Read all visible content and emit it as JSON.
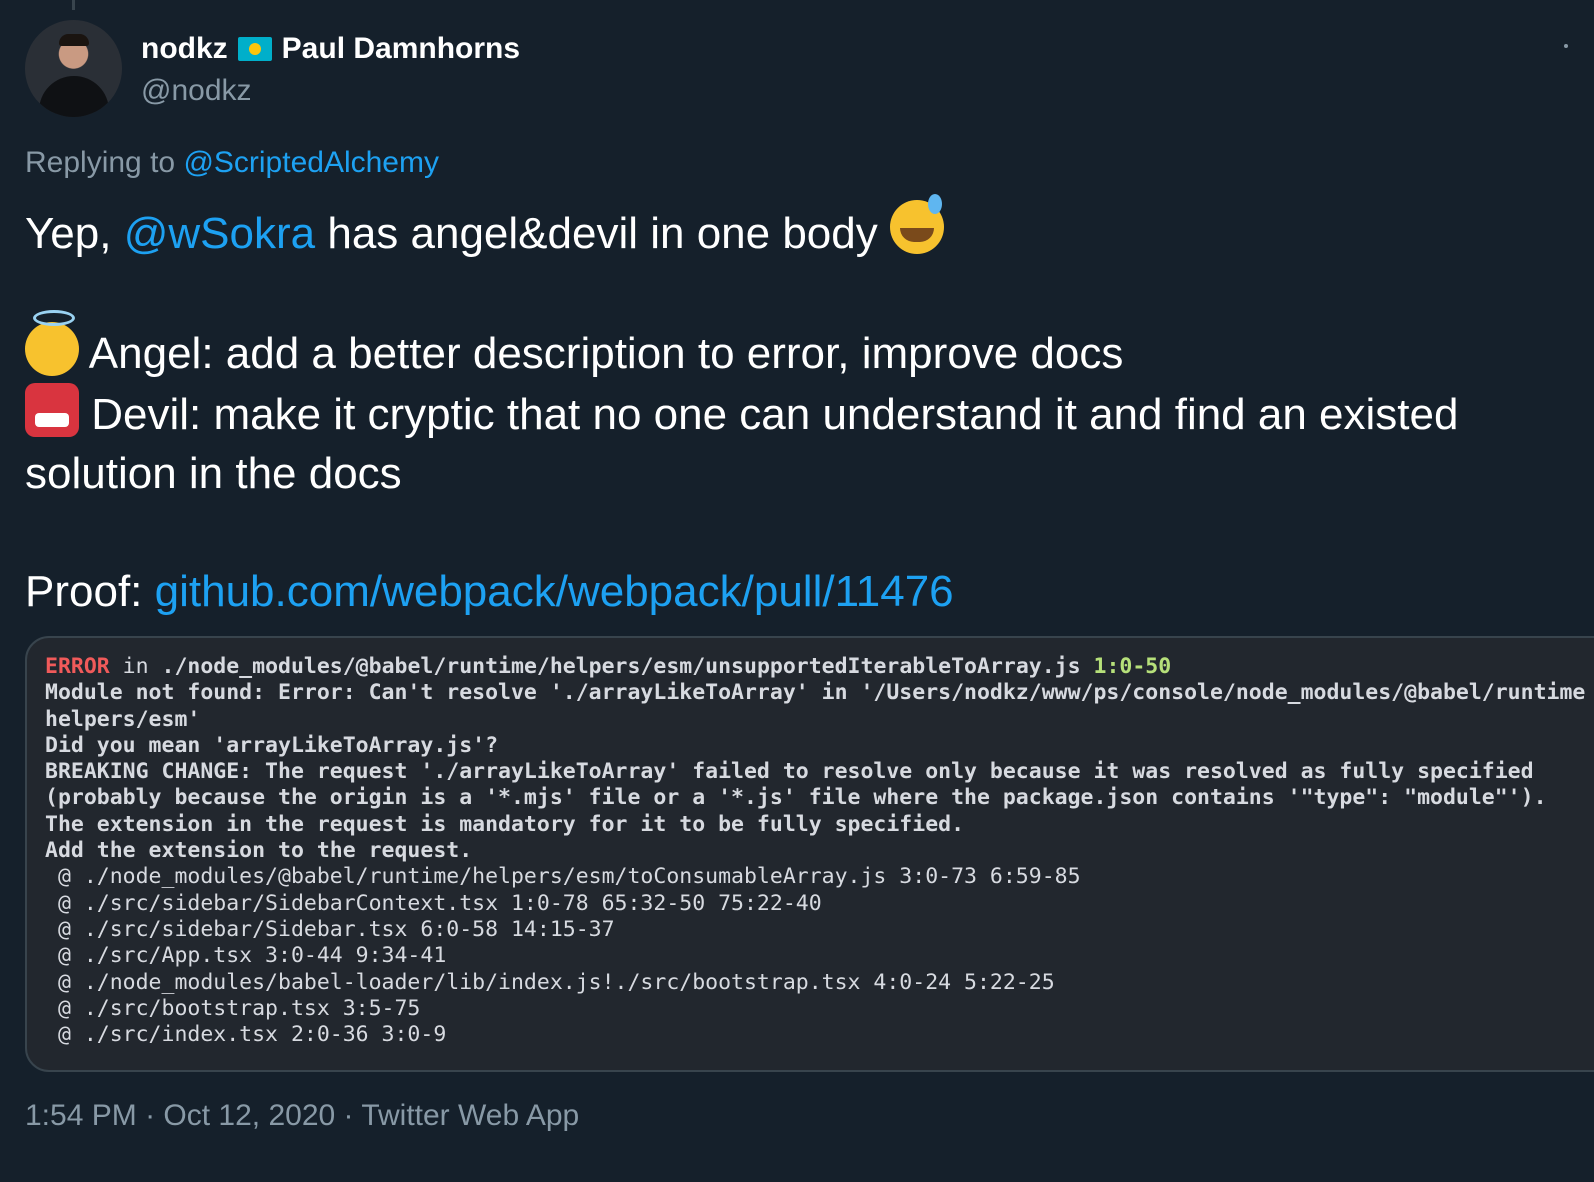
{
  "author": {
    "username": "nodkz",
    "flag_icon": "kazakhstan-flag-icon",
    "display_name": "Paul Damnhorns",
    "handle": "@nodkz"
  },
  "reply": {
    "prefix": "Replying to",
    "mention": "@ScriptedAlchemy"
  },
  "tweet": {
    "line1_prefix": "Yep,",
    "line1_mention": "@wSokra",
    "line1_suffix": "has angel&devil in one body",
    "line1_emoji": "grinning-sweat-emoji",
    "angel_emoji": "angel-emoji",
    "angel_text": "Angel: add a better description to error, improve docs",
    "devil_emoji": "ogre-emoji",
    "devil_text": "Devil: make it cryptic that no one can understand it and find an existed solution in the docs",
    "proof_label": "Proof:",
    "proof_link": "github.com/webpack/webpack/pull/11476"
  },
  "code": {
    "error_tag": "ERROR",
    "in_word": " in ",
    "error_file": "./node_modules/@babel/runtime/helpers/esm/unsupportedIterableToArray.js",
    "error_loc": "1:0-50",
    "bold_lines": [
      "Module not found: Error: Can't resolve './arrayLikeToArray' in '/Users/nodkz/www/ps/console/node_modules/@babel/runtime",
      "helpers/esm'",
      "Did you mean 'arrayLikeToArray.js'?",
      "BREAKING CHANGE: The request './arrayLikeToArray' failed to resolve only because it was resolved as fully specified",
      "(probably because the origin is a '*.mjs' file or a '*.js' file where the package.json contains '\"type\": \"module\"').",
      "The extension in the request is mandatory for it to be fully specified.",
      "Add the extension to the request."
    ],
    "trace_lines": [
      " @ ./node_modules/@babel/runtime/helpers/esm/toConsumableArray.js 3:0-73 6:59-85",
      " @ ./src/sidebar/SidebarContext.tsx 1:0-78 65:32-50 75:22-40",
      " @ ./src/sidebar/Sidebar.tsx 6:0-58 14:15-37",
      " @ ./src/App.tsx 3:0-44 9:34-41",
      " @ ./node_modules/babel-loader/lib/index.js!./src/bootstrap.tsx 4:0-24 5:22-25",
      " @ ./src/bootstrap.tsx 3:5-75",
      " @ ./src/index.tsx 2:0-36 3:0-9"
    ]
  },
  "meta": {
    "time": "1:54 PM",
    "date": "Oct 12, 2020",
    "source": "Twitter Web App",
    "separator": " · "
  },
  "colors": {
    "background": "#15202b",
    "link": "#1da1f2",
    "muted": "#8899a6",
    "error": "#f05a5a",
    "location": "#b6e07a"
  }
}
